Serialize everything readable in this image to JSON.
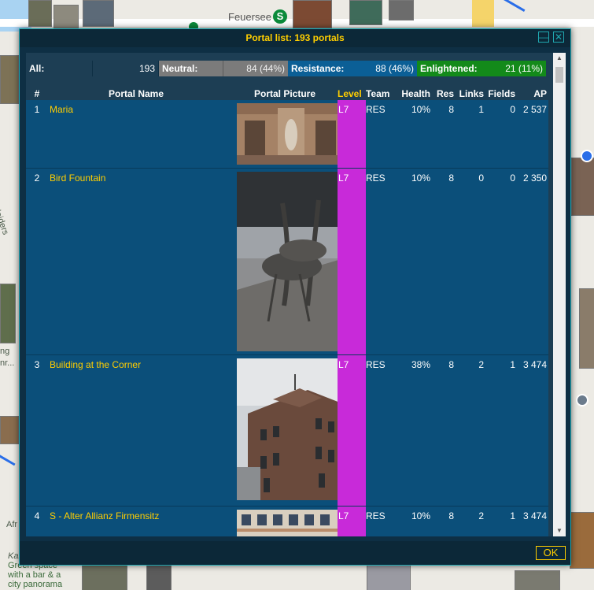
{
  "map": {
    "labels": {
      "feuersee": "Feuersee",
      "s_badge": "S",
      "afr": "Afr",
      "karlshoehe": "Karlshöhe",
      "karlshoehe_desc": "Green space with a bar & a city panorama",
      "nr": "nr...",
      "ng": "ng",
      "sleider": "sleiders"
    }
  },
  "dialog": {
    "title": "Portal list: 193 portals",
    "ok_label": "OK",
    "summary": {
      "all_label": "All:",
      "all_value": "193",
      "neutral_label": "Neutral:",
      "neutral_value": "84 (44%)",
      "resistance_label": "Resistance:",
      "resistance_value": "88 (46%)",
      "enlightened_label": "Enlightened:",
      "enlightened_value": "21 (11%)"
    },
    "columns": {
      "num": "#",
      "name": "Portal Name",
      "picture": "Portal Picture",
      "level": "Level",
      "team": "Team",
      "health": "Health",
      "res": "Res",
      "links": "Links",
      "fields": "Fields",
      "ap": "AP"
    },
    "rows": [
      {
        "num": "1",
        "name": "Maria",
        "level": "L7",
        "team": "RES",
        "health": "10%",
        "res": "8",
        "links": "1",
        "fields": "0",
        "ap": "2 537"
      },
      {
        "num": "2",
        "name": "Bird Fountain",
        "level": "L7",
        "team": "RES",
        "health": "10%",
        "res": "8",
        "links": "0",
        "fields": "0",
        "ap": "2 350"
      },
      {
        "num": "3",
        "name": "Building at the Corner",
        "level": "L7",
        "team": "RES",
        "health": "38%",
        "res": "8",
        "links": "2",
        "fields": "1",
        "ap": "3 474"
      },
      {
        "num": "4",
        "name": "S - Alter Allianz Firmensitz",
        "level": "L7",
        "team": "RES",
        "health": "10%",
        "res": "8",
        "links": "2",
        "fields": "1",
        "ap": "3 474"
      }
    ]
  },
  "colors": {
    "accent": "#ffce00",
    "frame": "#20a8b1",
    "row": "#0b4f7a",
    "level7": "#c82ad9",
    "neutral": "#7b7b7b",
    "resistance": "#0b5f96",
    "enlightened": "#138a1a"
  }
}
